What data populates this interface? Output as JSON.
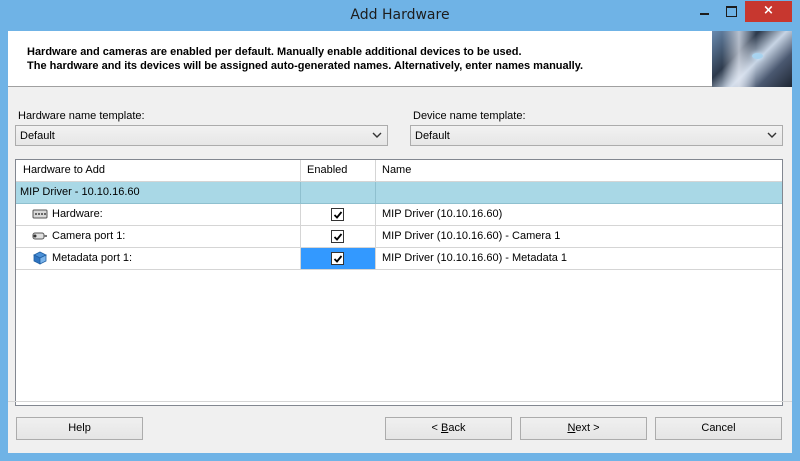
{
  "window": {
    "title": "Add Hardware",
    "close_glyph": "×"
  },
  "banner": {
    "line1": "Hardware and cameras are enabled per default. Manually enable additional devices to be used.",
    "line2": "The hardware and its devices will be assigned auto-generated names. Alternatively, enter names manually."
  },
  "hardware_template": {
    "label": "Hardware name template:",
    "value": "Default"
  },
  "device_template": {
    "label": "Device name template:",
    "value": "Default"
  },
  "grid": {
    "headers": [
      "Hardware to Add",
      "Enabled",
      "Name"
    ],
    "group": {
      "label": "MIP Driver - 10.10.16.60"
    },
    "rows": [
      {
        "label": "Hardware:",
        "icon": "hardware-icon",
        "enabled": true,
        "name": "MIP Driver (10.10.16.60)"
      },
      {
        "label": "Camera port 1:",
        "icon": "camera-icon",
        "enabled": true,
        "name": "MIP Driver (10.10.16.60) - Camera 1"
      },
      {
        "label": "Metadata port 1:",
        "icon": "metadata-icon",
        "enabled": true,
        "name": "MIP Driver (10.10.16.60) - Metadata 1"
      }
    ]
  },
  "buttons": {
    "help": "Help",
    "back_prefix": "< ",
    "back_mnemonic": "B",
    "back_rest": "ack",
    "next_mnemonic": "N",
    "next_rest": "ext >",
    "cancel": "Cancel"
  },
  "colors": {
    "title_bar": "#6fb3e6",
    "close_button": "#c7372f",
    "group_row": "#a9d8e6",
    "selection": "#3399ff"
  }
}
